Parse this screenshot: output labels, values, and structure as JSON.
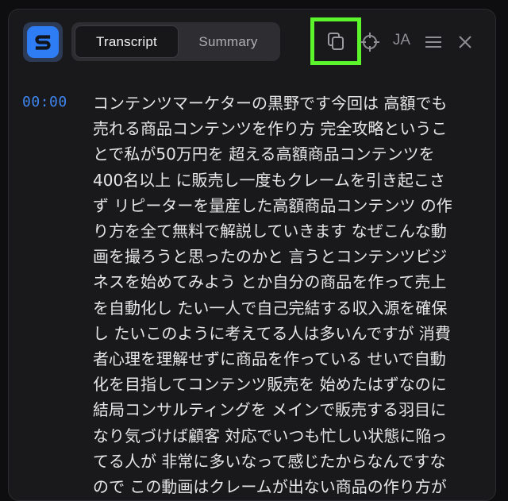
{
  "header": {
    "logo_letter": "S",
    "tabs": [
      {
        "label": "Transcript",
        "active": true
      },
      {
        "label": "Summary",
        "active": false
      }
    ],
    "language": "JA",
    "icons": [
      "copy-icon",
      "crosshair-icon",
      "menu-icon",
      "close-icon"
    ],
    "highlight_color": "#5cf52c",
    "accent_color": "#2f7df5"
  },
  "transcript": {
    "timestamp": "00:00",
    "lines": [
      "コンテンツマーケターの黒野です今回は 高額でも",
      "売れる商品コンテンツを作り方 完全攻略というこ",
      "とで私が50万円を 超える高額商品コンテンツを",
      "400名以上 に販売し一度もクレームを引き起こさ",
      "ず リピーターを量産した高額商品コンテンツ の作",
      "り方を全て無料で解説していきます なぜこんな動",
      "画を撮ろうと思ったのかと 言うとコンテンツビジ",
      "ネスを始めてみよう とか自分の商品を作って売上",
      "を自動化し たい一人で自己完結する収入源を確保",
      "し たいこのように考えてる人は多いんですが 消費",
      "者心理を理解せずに商品を作っている せいで自動",
      "化を目指してコンテンツ販売を 始めたはずなのに",
      "結局コンサルティングを メインで販売する羽目に",
      "なり気づけば顧客 対応でいつも忙しい状態に陥っ",
      "てる人が 非常に多いなって感じたからなんですな",
      "ので この動画はクレームが出ない商品の作り方が"
    ]
  }
}
